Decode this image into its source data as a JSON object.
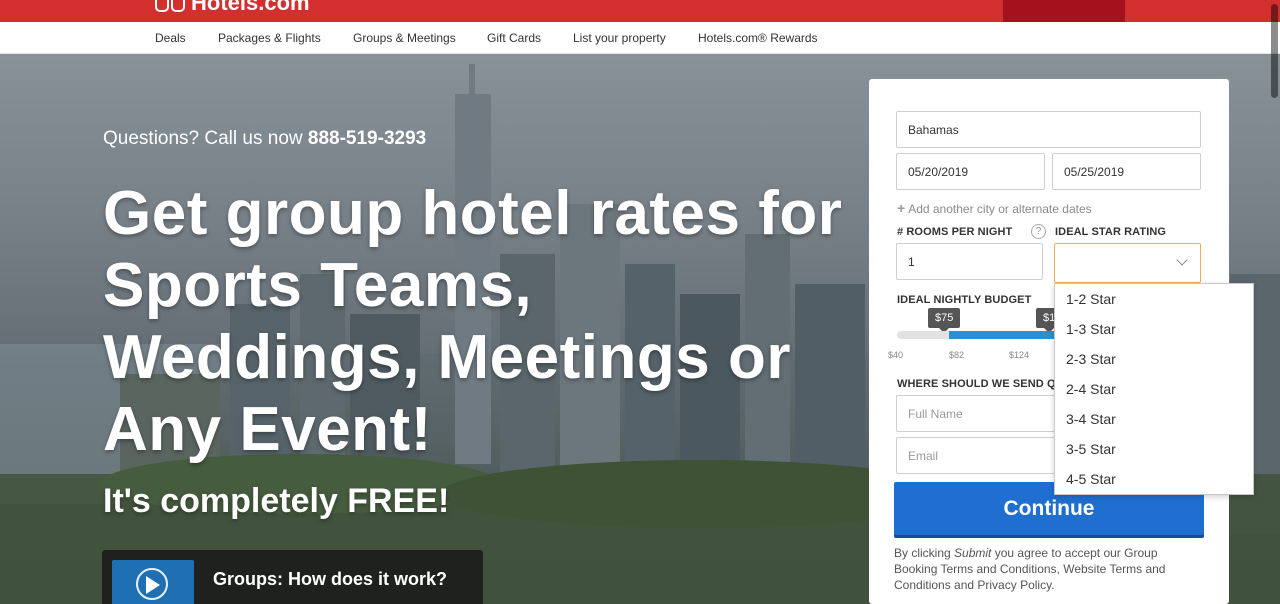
{
  "brand": {
    "name": "Hotels.com",
    "color": "#d32f2f"
  },
  "nav": {
    "items": [
      "Deals",
      "Packages & Flights",
      "Groups & Meetings",
      "Gift Cards",
      "List your property",
      "Hotels.com® Rewards"
    ]
  },
  "hero": {
    "phone_prefix": "Questions? Call us now ",
    "phone_number": "888-519-3293",
    "headline_lines": [
      "Get group hotel rates for",
      "Sports Teams,",
      "Weddings, Meetings or",
      "Any Event!"
    ],
    "free_text": "It's completely FREE!",
    "video_label": "Groups: How does it work?"
  },
  "form": {
    "destination": "Bahamas",
    "checkin": "05/20/2019",
    "checkout": "05/25/2019",
    "add_city": "Add another city or alternate dates",
    "rooms_label": "# ROOMS PER NIGHT",
    "rooms_value": "1",
    "help_icon": "?",
    "star_label": "IDEAL STAR RATING",
    "star_value": "",
    "budget_label": "IDEAL NIGHTLY BUDGET",
    "budget_min_tip": "$75",
    "budget_max_tip": "$1",
    "ticks": [
      "$40",
      "$82",
      "$124"
    ],
    "quote_label": "WHERE SHOULD WE SEND QU",
    "fullname_placeholder": "Full Name",
    "email_placeholder": "Email",
    "continue_label": "Continue",
    "legal_prefix": "By clicking ",
    "legal_submit": "Submit",
    "legal_rest": " you agree to accept our Group Booking Terms and Conditions, Website Terms and Conditions and Privacy Policy.",
    "accent_color": "#1f6fd0"
  },
  "star_dropdown": {
    "options": [
      "1-2 Star",
      "1-3 Star",
      "2-3 Star",
      "2-4 Star",
      "3-4 Star",
      "3-5 Star",
      "4-5 Star"
    ]
  }
}
